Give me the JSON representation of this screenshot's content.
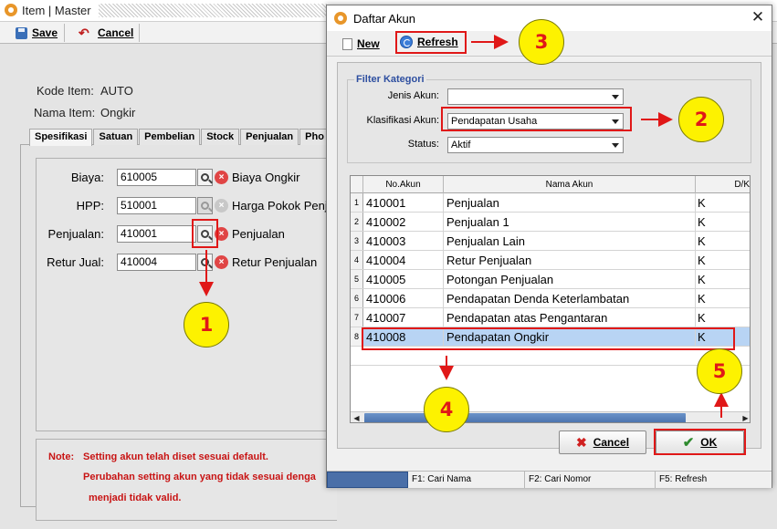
{
  "bg_window": {
    "title": "Item | Master",
    "toolbar": {
      "save_label": "Save",
      "cancel_label": "Cancel"
    },
    "fields": {
      "kode_label": "Kode Item:",
      "kode_value": "AUTO",
      "nama_label": "Nama Item:",
      "nama_value": "Ongkir"
    },
    "tabs": [
      "Spesifikasi",
      "Satuan",
      "Pembelian",
      "Stock",
      "Penjualan",
      "Pho"
    ],
    "accounts": [
      {
        "label": "Biaya:",
        "value": "610005",
        "name": "Biaya Ongkir",
        "enabled": true
      },
      {
        "label": "HPP:",
        "value": "510001",
        "name": "Harga Pokok Penj",
        "enabled": false
      },
      {
        "label": "Penjualan:",
        "value": "410001",
        "name": "Penjualan",
        "enabled": true
      },
      {
        "label": "Retur Jual:",
        "value": "410004",
        "name": "Retur Penjualan",
        "enabled": true
      }
    ],
    "note": {
      "label": "Note:",
      "line1": "Setting akun telah diset sesuai default.",
      "line2": "Perubahan setting akun yang tidak sesuai denga",
      "line3": "menjadi tidak valid."
    }
  },
  "dialog": {
    "title": "Daftar Akun",
    "toolbar": {
      "new_label": "New",
      "refresh_label": "Refresh"
    },
    "filter": {
      "title": "Filter Kategori",
      "jenis_label": "Jenis Akun:",
      "jenis_value": "",
      "klasifikasi_label": "Klasifikasi Akun:",
      "klasifikasi_value": "Pendapatan Usaha",
      "status_label": "Status:",
      "status_value": "Aktif"
    },
    "grid": {
      "columns": [
        "No.Akun",
        "Nama Akun",
        "D/K"
      ],
      "rows": [
        {
          "idx": "1",
          "no": "410001",
          "nama": "Penjualan",
          "dk": "K"
        },
        {
          "idx": "2",
          "no": "410002",
          "nama": "Penjualan 1",
          "dk": "K"
        },
        {
          "idx": "3",
          "no": "410003",
          "nama": "Penjualan Lain",
          "dk": "K"
        },
        {
          "idx": "4",
          "no": "410004",
          "nama": "Retur Penjualan",
          "dk": "K"
        },
        {
          "idx": "5",
          "no": "410005",
          "nama": "Potongan Penjualan",
          "dk": "K"
        },
        {
          "idx": "6",
          "no": "410006",
          "nama": "Pendapatan Denda Keterlambatan",
          "dk": "K"
        },
        {
          "idx": "7",
          "no": "410007",
          "nama": "Pendapatan atas Pengantaran",
          "dk": "K"
        },
        {
          "idx": "8",
          "no": "410008",
          "nama": "Pendapatan Ongkir",
          "dk": "K"
        }
      ],
      "selected_index": 7
    },
    "buttons": {
      "cancel_label": "Cancel",
      "ok_label": "OK"
    },
    "statusbar": [
      "",
      "F1: Cari Nama",
      "F2: Cari Nomor",
      "F5: Refresh"
    ]
  },
  "annotations": {
    "color": "#e01818",
    "circle_color": "#fdf200",
    "steps": [
      "1",
      "2",
      "3",
      "4",
      "5"
    ]
  },
  "icons": [
    "app-icon",
    "save-icon",
    "undo-icon",
    "search-icon",
    "clear-icon",
    "close-icon",
    "new-doc-icon",
    "refresh-icon",
    "cancel-x-icon",
    "check-icon"
  ]
}
